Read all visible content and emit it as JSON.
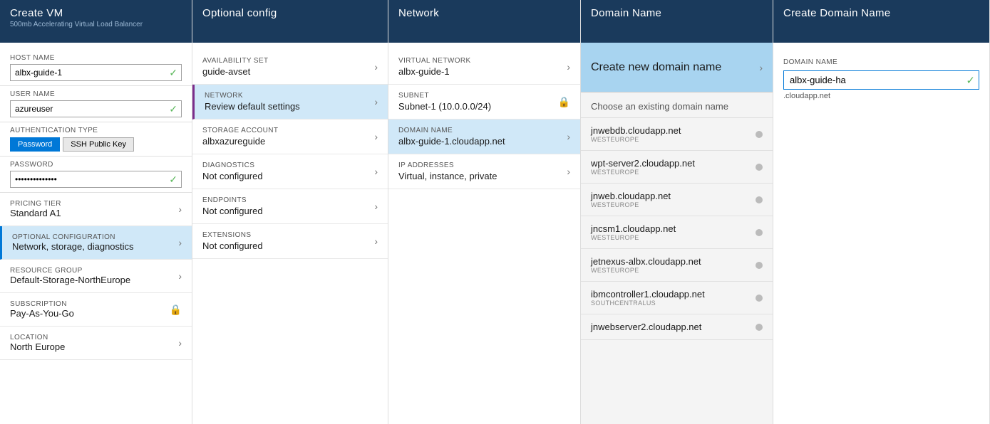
{
  "createvm": {
    "header_title": "Create VM",
    "header_subtitle": "500mb Accelerating Virtual Load Balancer",
    "fields": {
      "hostname_label": "Host Name",
      "hostname_value": "albx-guide-1",
      "username_label": "User Name",
      "username_value": "azureuser",
      "auth_label": "Authentication Type",
      "auth_options": [
        "Password",
        "SSH Public Key"
      ],
      "auth_selected": "Password",
      "password_label": "Password",
      "password_dots": "••••••••••••"
    },
    "nav_items": [
      {
        "label": "PRICING TIER",
        "value": "Standard A1",
        "type": "nav"
      },
      {
        "label": "OPTIONAL CONFIGURATION",
        "value": "Network, storage, diagnostics",
        "type": "nav-selected"
      },
      {
        "label": "RESOURCE GROUP",
        "value": "Default-Storage-NorthEurope",
        "type": "nav"
      },
      {
        "label": "SUBSCRIPTION",
        "value": "Pay-As-You-Go",
        "type": "lock"
      },
      {
        "label": "LOCATION",
        "value": "North Europe",
        "type": "nav"
      }
    ]
  },
  "optconfig": {
    "header_title": "Optional config",
    "items": [
      {
        "label": "AVAILABILITY SET",
        "value": "guide-avset",
        "selected": false
      },
      {
        "label": "NETWORK",
        "value": "Review default settings",
        "selected": true
      },
      {
        "label": "STORAGE ACCOUNT",
        "value": "albxazureguide",
        "selected": false
      },
      {
        "label": "DIAGNOSTICS",
        "value": "Not configured",
        "selected": false
      },
      {
        "label": "ENDPOINTS",
        "value": "Not configured",
        "selected": false
      },
      {
        "label": "EXTENSIONS",
        "value": "Not configured",
        "selected": false
      }
    ]
  },
  "network": {
    "header_title": "Network",
    "items": [
      {
        "label": "VIRTUAL NETWORK",
        "value": "albx-guide-1",
        "selected": false,
        "icon": "arrow"
      },
      {
        "label": "SUBNET",
        "value": "Subnet-1 (10.0.0.0/24)",
        "selected": false,
        "icon": "lock"
      },
      {
        "label": "DOMAIN NAME",
        "value": "albx-guide-1.cloudapp.net",
        "selected": true,
        "icon": "arrow"
      },
      {
        "label": "IP ADDRESSES",
        "value": "Virtual, instance, private",
        "selected": false,
        "icon": "arrow"
      }
    ]
  },
  "domainname": {
    "header_title": "Domain Name",
    "create_label": "Create new domain name",
    "choose_label": "Choose an existing domain name",
    "existing_domains": [
      {
        "name": "jnwebdb.cloudapp.net",
        "region": "WESTEUROPE"
      },
      {
        "name": "wpt-server2.cloudapp.net",
        "region": "WESTEUROPE"
      },
      {
        "name": "jnweb.cloudapp.net",
        "region": "WESTEUROPE"
      },
      {
        "name": "jncsm1.cloudapp.net",
        "region": "WESTEUROPE"
      },
      {
        "name": "jetnexus-albx.cloudapp.net",
        "region": "WESTEUROPE"
      },
      {
        "name": "ibmcontroller1.cloudapp.net",
        "region": "SOUTHCENTRALUS"
      },
      {
        "name": "jnwebserver2.cloudapp.net",
        "region": ""
      }
    ]
  },
  "createdomainname": {
    "header_title": "Create Domain Name",
    "input_label": "Domain Name",
    "input_value": "albx-guide-ha",
    "input_suffix": ".cloudapp.net"
  }
}
